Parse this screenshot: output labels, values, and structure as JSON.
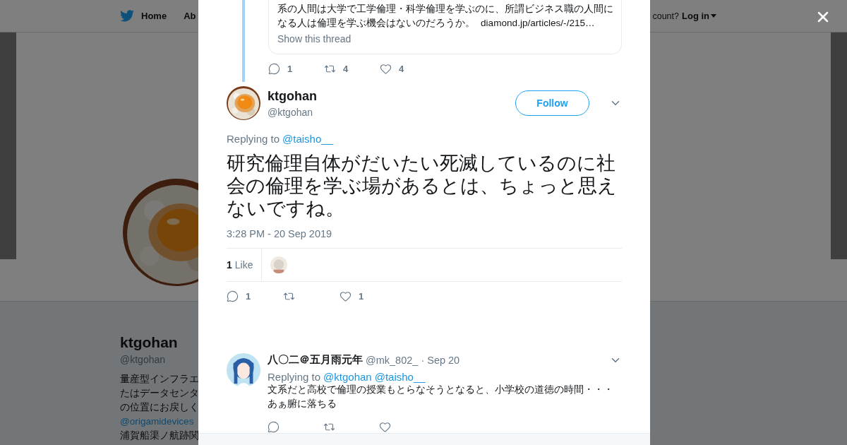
{
  "background_page": {
    "nav": {
      "items": [
        {
          "label": "Home",
          "kind": "home"
        },
        {
          "label": "Ab",
          "kind": "plain"
        }
      ],
      "account_prompt": "count?",
      "login": "Log in"
    },
    "profile": {
      "name": "ktgohan",
      "handle": "@ktgohan",
      "bio_lines": [
        {
          "text": "量産型インフラエ",
          "kind": "text"
        },
        {
          "text": "たはデータセンタ",
          "kind": "text"
        },
        {
          "text": "の位置にお戻しく",
          "kind": "text"
        },
        {
          "text": "@origamidevices",
          "kind": "link"
        },
        {
          "text": "浦賀船渠ノ航跡関",
          "kind": "text"
        }
      ]
    }
  },
  "modal": {
    "thread_context": {
      "card_lines": [
        "系の人間は大学で工学倫理・科学倫理を学ぶのに、所謂ビジネス職の人間に",
        "なる人は倫理を学ぶ機会はないのだろうか。"
      ],
      "link": "diamond.jp/articles/-/215…",
      "show_thread": "Show this thread",
      "actions": [
        {
          "kind": "reply",
          "count": "1"
        },
        {
          "kind": "retweet",
          "count": "4"
        },
        {
          "kind": "like",
          "count": "4"
        }
      ]
    },
    "tweet": {
      "name": "ktgohan",
      "handle": "@ktgohan",
      "follow": "Follow",
      "replying_label": "Replying to",
      "replying_to": [
        "@taisho__"
      ],
      "text": "研究倫理自体がだいたい死滅しているのに社会の倫理を学ぶ場があるとは、ちょっと思えないですね。",
      "timestamp": "3:28 PM - 20 Sep 2019",
      "likes_count": "1",
      "likes_label": "Like",
      "actions": [
        {
          "kind": "reply",
          "count": "1"
        },
        {
          "kind": "retweet"
        },
        {
          "kind": "like",
          "count": "1"
        }
      ]
    },
    "replies": [
      {
        "name": "八〇二＠五月雨元年",
        "handle": "@mk_802_",
        "date": "· Sep 20",
        "replying_label": "Replying to",
        "replying_to": [
          "@ktgohan",
          "@taisho__"
        ],
        "text_lines": [
          "文系だと高校で倫理の授業もとらなそうとなると、小学校の道徳の時間・・・",
          "あぁ腑に落ちる"
        ],
        "actions": [
          {
            "kind": "reply"
          },
          {
            "kind": "retweet"
          },
          {
            "kind": "like"
          }
        ]
      }
    ]
  }
}
